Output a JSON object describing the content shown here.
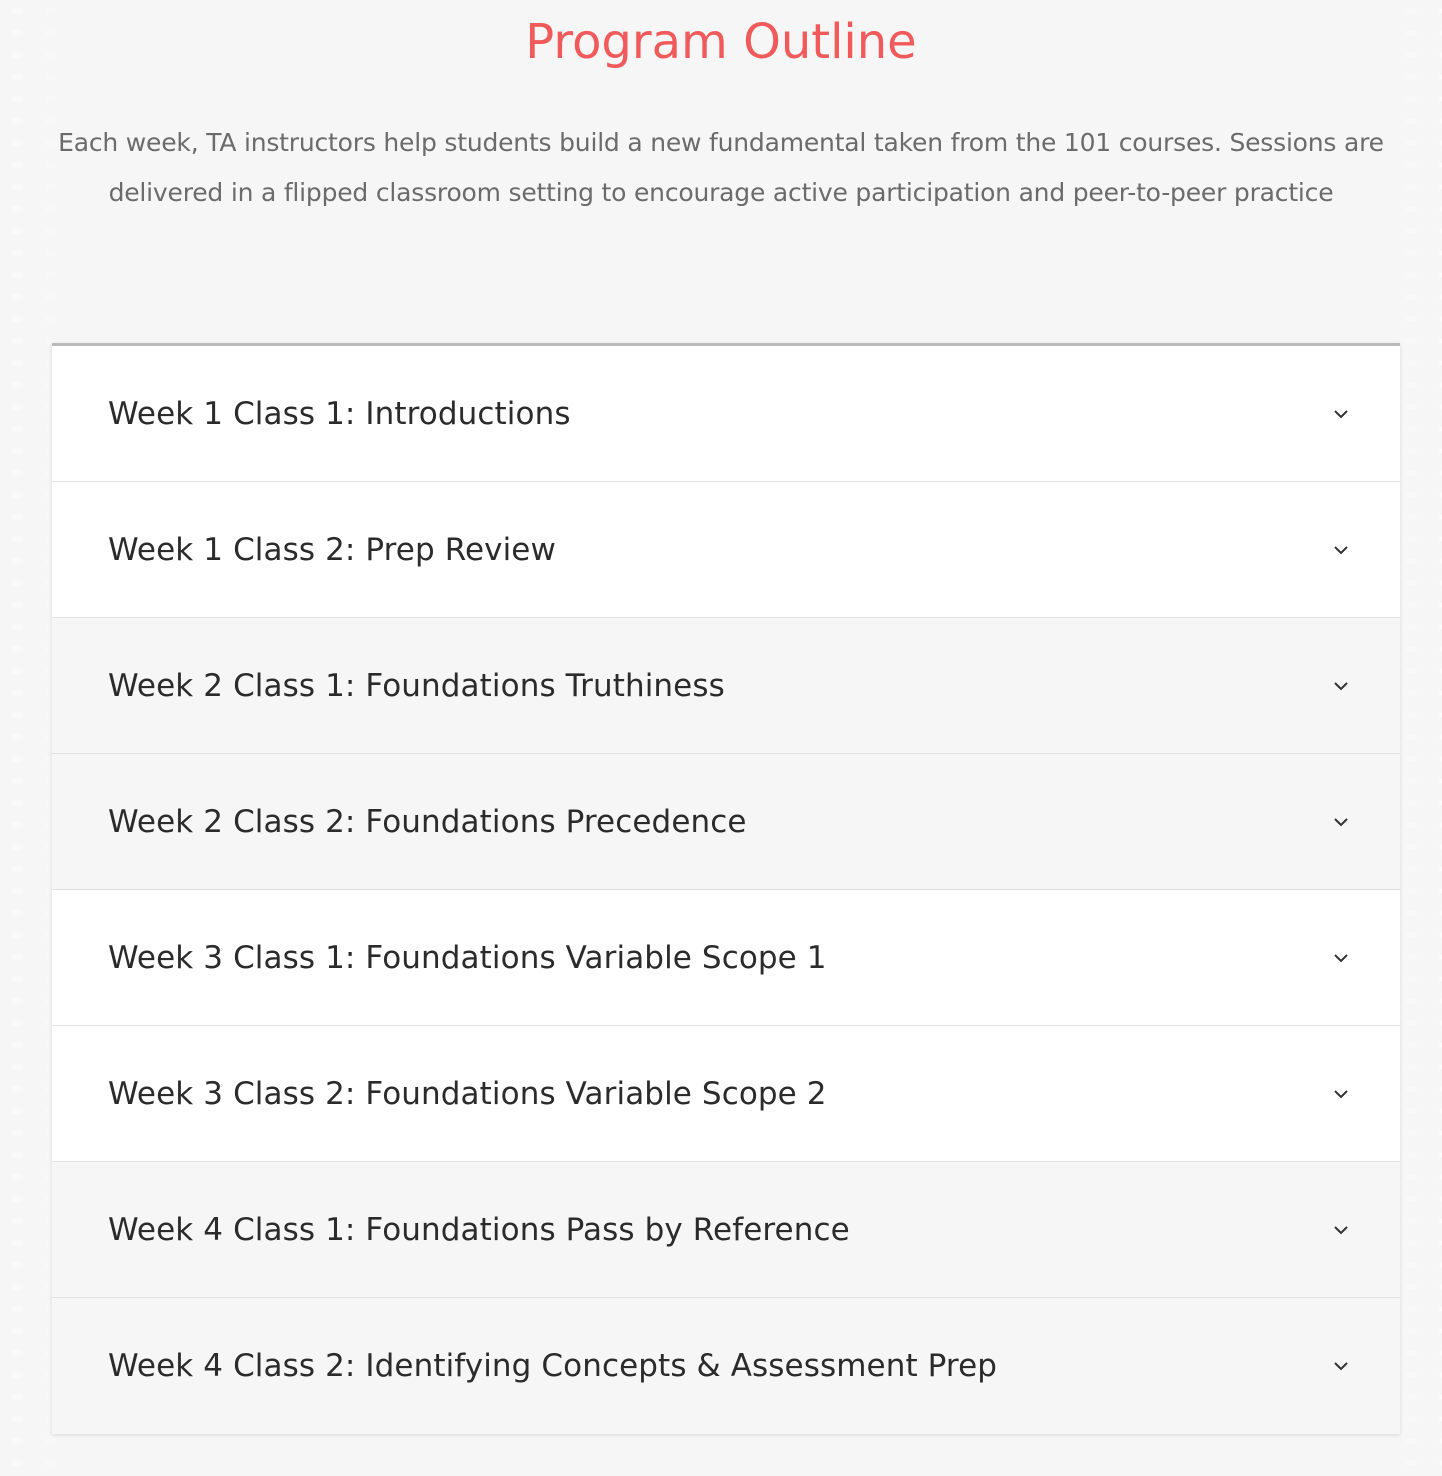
{
  "header": {
    "title": "Program Outline",
    "intro_line1": "Each week, TA instructors help students build a new fundamental taken from the 101 courses. Sessions are",
    "intro_line2": "delivered in a flipped classroom setting to encourage active participation and peer-to-peer practice"
  },
  "colors": {
    "title": "#f05a5b",
    "text": "#2b2b2b",
    "muted": "#6b6b6b",
    "row_alt": "#f6f6f6"
  },
  "accordion": {
    "items": [
      {
        "label": "Week 1 Class 1: Introductions",
        "icon": "chevron-down-icon"
      },
      {
        "label": "Week 1 Class 2: Prep Review",
        "icon": "chevron-down-icon"
      },
      {
        "label": "Week 2 Class 1: Foundations Truthiness",
        "icon": "chevron-down-icon"
      },
      {
        "label": "Week 2 Class 2: Foundations Precedence",
        "icon": "chevron-down-icon"
      },
      {
        "label": "Week 3 Class 1: Foundations Variable Scope 1",
        "icon": "chevron-down-icon"
      },
      {
        "label": "Week 3 Class 2: Foundations Variable Scope 2",
        "icon": "chevron-down-icon"
      },
      {
        "label": "Week 4 Class 1: Foundations Pass by Reference",
        "icon": "chevron-down-icon"
      },
      {
        "label": "Week 4 Class 2: Identifying Concepts & Assessment Prep",
        "icon": "chevron-down-icon"
      }
    ]
  }
}
